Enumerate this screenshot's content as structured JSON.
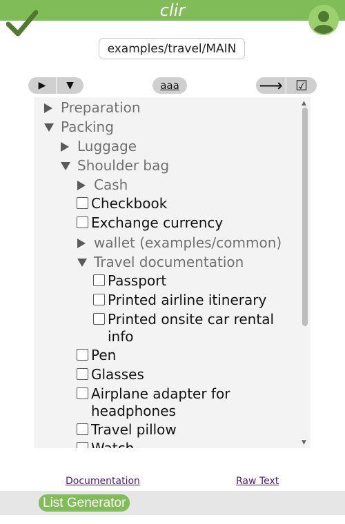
{
  "header": {
    "app_title": "clir",
    "accent_color": "#80bd58",
    "done_icon": "check-icon",
    "avatar_icon": "user-avatar-icon"
  },
  "path_field": {
    "value": "examples/travel/MAIN"
  },
  "toolbar": {
    "expand_icon": "▶",
    "collapse_icon": "▼",
    "font_size_label": "aaa",
    "next_icon": "⟶",
    "checkbox_icon": "☑"
  },
  "tree": {
    "items": [
      {
        "label": "Preparation",
        "kind": "folder",
        "expanded": false
      },
      {
        "label": "Packing",
        "kind": "folder",
        "expanded": true
      },
      {
        "label": "Luggage",
        "kind": "folder",
        "expanded": false
      },
      {
        "label": "Shoulder bag",
        "kind": "folder",
        "expanded": true
      },
      {
        "label": "Cash",
        "kind": "folder",
        "expanded": false
      },
      {
        "label": "Checkbook",
        "kind": "task",
        "checked": false
      },
      {
        "label": "Exchange currency",
        "kind": "task",
        "checked": false
      },
      {
        "label": "wallet (examples/common)",
        "kind": "folder",
        "expanded": false
      },
      {
        "label": "Travel documentation",
        "kind": "folder",
        "expanded": true
      },
      {
        "label": "Passport",
        "kind": "task",
        "checked": false
      },
      {
        "label": "Printed airline itinerary",
        "kind": "task",
        "checked": false
      },
      {
        "label": "Printed onsite car rental info",
        "kind": "task",
        "checked": false
      },
      {
        "label": "Pen",
        "kind": "task",
        "checked": false
      },
      {
        "label": "Glasses",
        "kind": "task",
        "checked": false
      },
      {
        "label": "Airplane adapter for headphones",
        "kind": "task",
        "checked": false
      },
      {
        "label": "Travel pillow",
        "kind": "task",
        "checked": false
      },
      {
        "label": "Watch",
        "kind": "task",
        "checked": false
      }
    ]
  },
  "links": {
    "documentation": "Documentation",
    "raw_text": "Raw Text"
  },
  "footer": {
    "generator_label": "List Generator"
  }
}
